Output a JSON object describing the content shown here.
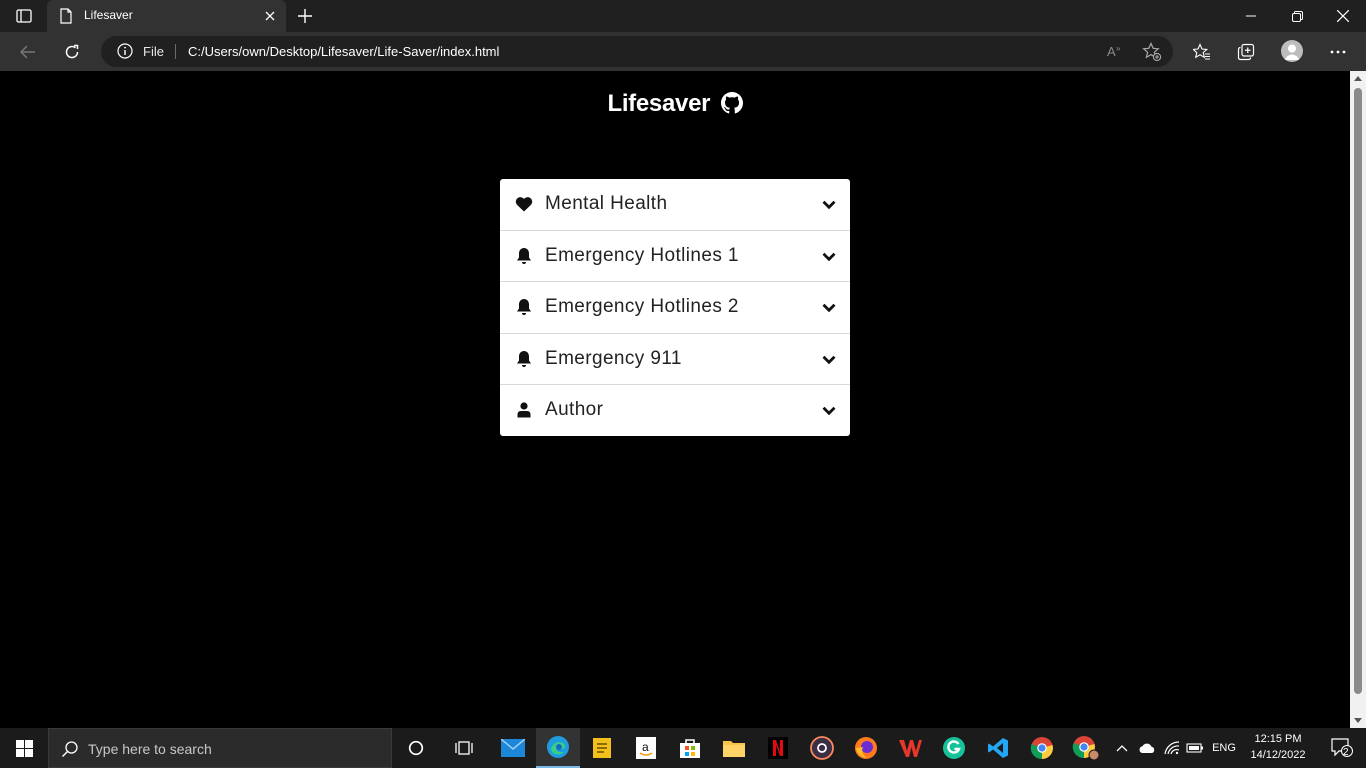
{
  "browser": {
    "tab": {
      "title": "Lifesaver"
    },
    "address": {
      "scheme_label": "File",
      "url": "C:/Users/own/Desktop/Lifesaver/Life-Saver/index.html"
    }
  },
  "page": {
    "brand": "Lifesaver",
    "accordion": [
      {
        "label": "Mental Health",
        "icon": "heart-icon"
      },
      {
        "label": "Emergency Hotlines 1",
        "icon": "bell-icon"
      },
      {
        "label": "Emergency Hotlines 2",
        "icon": "bell-icon"
      },
      {
        "label": "Emergency 911",
        "icon": "bell-icon"
      },
      {
        "label": "Author",
        "icon": "user-icon"
      }
    ]
  },
  "taskbar": {
    "search_placeholder": "Type here to search",
    "language": "ENG",
    "time": "12:15 PM",
    "date": "14/12/2022",
    "notification_count": "2"
  },
  "colors": {
    "page_bg": "#000000",
    "card_bg": "#ffffff",
    "accent": "#7ab8e6"
  }
}
